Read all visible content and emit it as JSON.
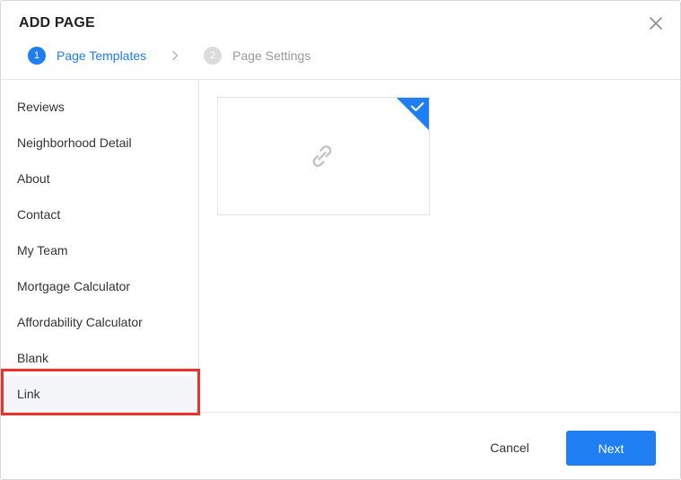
{
  "dialog": {
    "title": "ADD PAGE",
    "close_icon": "close-icon"
  },
  "steps": [
    {
      "number": "1",
      "label": "Page Templates",
      "state": "active"
    },
    {
      "number": "2",
      "label": "Page Settings",
      "state": "inactive"
    }
  ],
  "sidebar": {
    "items": [
      {
        "label": "Reviews"
      },
      {
        "label": "Neighborhood Detail"
      },
      {
        "label": "About"
      },
      {
        "label": "Contact"
      },
      {
        "label": "My Team"
      },
      {
        "label": "Mortgage Calculator"
      },
      {
        "label": "Affordability Calculator"
      },
      {
        "label": "Blank"
      },
      {
        "label": "Link",
        "selected": true
      }
    ]
  },
  "template": {
    "icon": "link-icon",
    "selected": true,
    "check_icon": "checkmark-icon"
  },
  "footer": {
    "cancel_label": "Cancel",
    "next_label": "Next"
  },
  "colors": {
    "accent": "#1f7ef2",
    "highlight": "#f0302a",
    "selected_bg": "#f4f5f9"
  }
}
